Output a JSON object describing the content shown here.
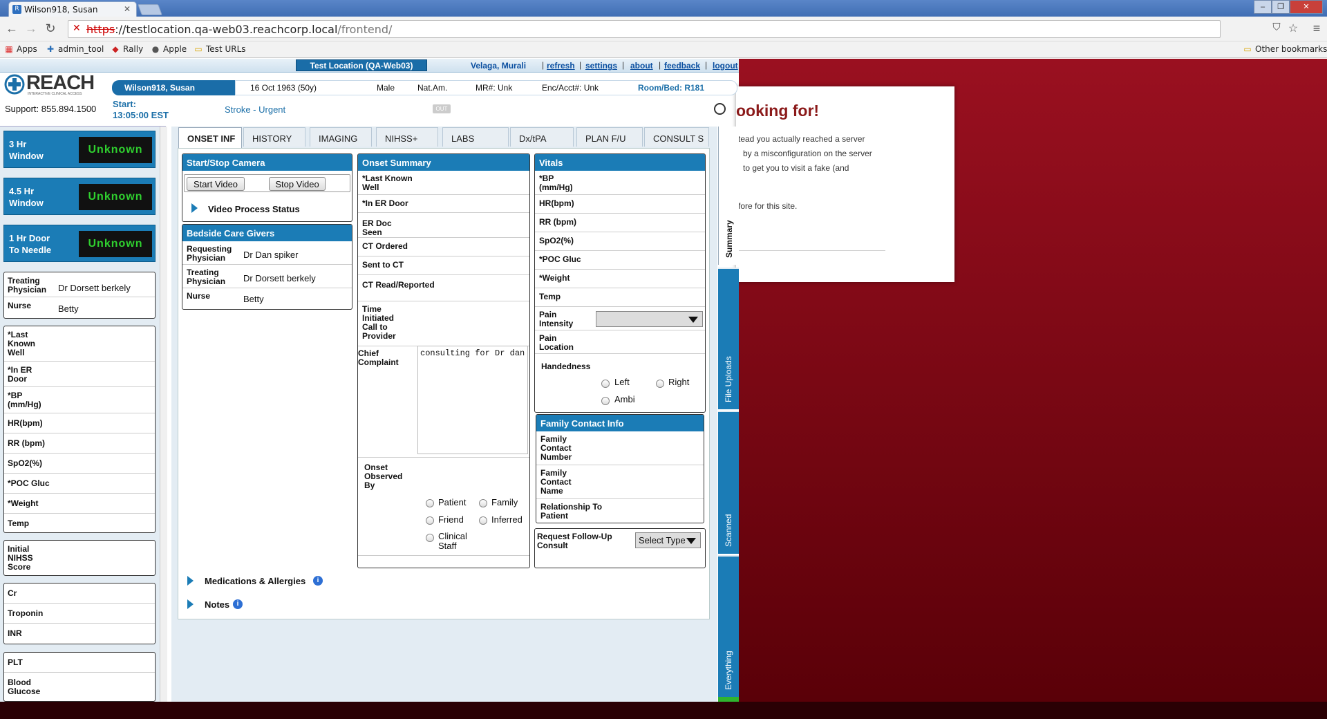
{
  "browser": {
    "tab_title": "Wilson918, Susan",
    "url_proto": "https",
    "url_host": "://testlocation.qa-web03.reachcorp.local",
    "url_path": "/frontend/",
    "bookmarks": [
      "Apps",
      "admin_tool",
      "Rally",
      "Apple",
      "Test URLs"
    ],
    "other_bookmarks": "Other bookmarks"
  },
  "header": {
    "location": "Test Location (QA-Web03)",
    "user": "Velaga, Murali",
    "links": [
      "refresh",
      "settings",
      "about",
      "feedback",
      "logout"
    ],
    "logo_text": "REACH",
    "logo_sub": "INTERACTIVE CLINICAL ACCESS",
    "support": "Support: 855.894.1500",
    "start_label": "Start:",
    "start_time": "13:05:00 EST",
    "case_type": "Stroke - Urgent",
    "out_badge": "OUT"
  },
  "patient": {
    "name": "Wilson918, Susan",
    "dob": "16 Oct 1963 (50y)",
    "sex": "Male",
    "race": "Nat.Am.",
    "mr": "MR#: Unk",
    "enc": "Enc/Acct#: Unk",
    "room": "Room/Bed: R181"
  },
  "windows": [
    {
      "label1": "3 Hr",
      "label2": "Window",
      "value": "Unknown"
    },
    {
      "label1": "4.5 Hr",
      "label2": "Window",
      "value": "Unknown"
    },
    {
      "label1": "1 Hr Door",
      "label2": "To Needle",
      "value": "Unknown"
    }
  ],
  "left_care": {
    "treating_label": "Treating Physician",
    "treating_value": "Dr Dorsett berkely",
    "nurse_label": "Nurse",
    "nurse_value": "Betty"
  },
  "left_vitals": [
    "*Last Known Well",
    "*In ER Door",
    "*BP (mm/Hg)",
    "HR(bpm)",
    "RR (bpm)",
    "SpO2(%)",
    "*POC Gluc",
    "*Weight",
    "Temp"
  ],
  "left_nihss": "Initial NIHSS Score",
  "left_labs": [
    "Cr",
    "Troponin",
    "INR"
  ],
  "left_labs2": [
    "PLT",
    "Blood Glucose"
  ],
  "tabs": [
    "ONSET INF",
    "HISTORY",
    "IMAGING",
    "NIHSS+",
    "LABS",
    "Dx/tPA",
    "PLAN F/U",
    "CONSULT S"
  ],
  "camera": {
    "title": "Start/Stop Camera",
    "start": "Start Video",
    "stop": "Stop Video",
    "status": "Video Process Status"
  },
  "caregivers": {
    "title": "Bedside Care Givers",
    "req_label": "Requesting Physician",
    "req_value": "Dr Dan spiker",
    "treat_label": "Treating Physician",
    "treat_value": "Dr Dorsett berkely",
    "nurse_label": "Nurse",
    "nurse_value": "Betty"
  },
  "onset": {
    "title": "Onset Summary",
    "fields": [
      "*Last Known Well",
      "*In ER Door",
      "ER Doc Seen",
      "CT Ordered",
      "Sent to CT",
      "CT Read/Reported",
      "Time Initiated Call to Provider"
    ],
    "complaint_label": "Chief Complaint",
    "complaint_value": "consulting for Dr dan",
    "observed_label": "Onset Observed By",
    "observed_options": [
      "Patient",
      "Family",
      "Friend",
      "Inferred",
      "Clinical Staff"
    ]
  },
  "vitals": {
    "title": "Vitals",
    "fields": [
      "*BP (mm/Hg)",
      "HR(bpm)",
      "RR (bpm)",
      "SpO2(%)",
      "*POC Gluc",
      "*Weight",
      "Temp"
    ],
    "pain_intensity": "Pain Intensity",
    "pain_location": "Pain Location",
    "handedness": "Handedness",
    "hand_options": [
      "Left",
      "Right",
      "Ambi"
    ]
  },
  "family": {
    "title": "Family Contact Info",
    "number": "Family Contact Number",
    "name": "Family Contact Name",
    "relationship": "Relationship To Patient"
  },
  "followup": {
    "label": "Request Follow-Up Consult",
    "select": "Select Type"
  },
  "expanders": [
    "Medications & Allergies",
    "Notes"
  ],
  "side_tabs": [
    "Summary",
    "File Uploads",
    "Scanned",
    "Everything"
  ],
  "error_page": {
    "heading": "ooking for!",
    "lines": [
      "tead you actually reached a server",
      "by a misconfiguration on the server",
      "to get you to visit a fake (and",
      "",
      "fore for this site."
    ]
  }
}
